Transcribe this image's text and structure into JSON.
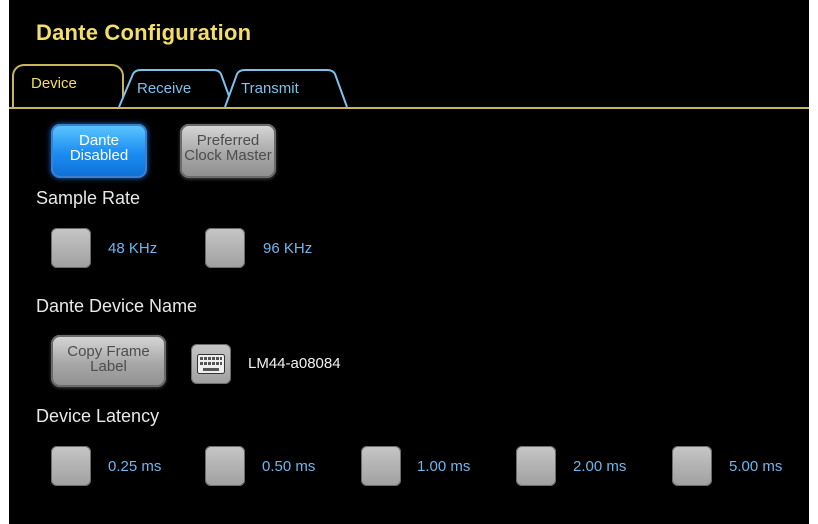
{
  "title": "Dante Configuration",
  "tabs": [
    {
      "label": "Device",
      "active": true
    },
    {
      "label": "Receive",
      "active": false
    },
    {
      "label": "Transmit",
      "active": false
    }
  ],
  "buttons": {
    "dante": {
      "line1": "Dante",
      "line2": "Disabled",
      "state": "on"
    },
    "clock": {
      "line1": "Preferred",
      "line2": "Clock Master",
      "state": "off"
    },
    "copy": {
      "line1": "Copy Frame",
      "line2": "Label"
    }
  },
  "sample_rate": {
    "heading": "Sample Rate",
    "options": [
      "48 KHz",
      "96 KHz"
    ]
  },
  "device_name": {
    "heading": "Dante Device Name",
    "value": "LM44-a08084",
    "keyboard_icon": "keyboard-icon"
  },
  "latency": {
    "heading": "Device Latency",
    "options": [
      "0.25 ms",
      "0.50 ms",
      "1.00 ms",
      "2.00 ms",
      "5.00 ms"
    ]
  },
  "colors": {
    "title": "#f3df66",
    "option_text": "#6fb6ee",
    "active_button": "#1a8cf2",
    "inactive_button": "#a7a7a7"
  }
}
